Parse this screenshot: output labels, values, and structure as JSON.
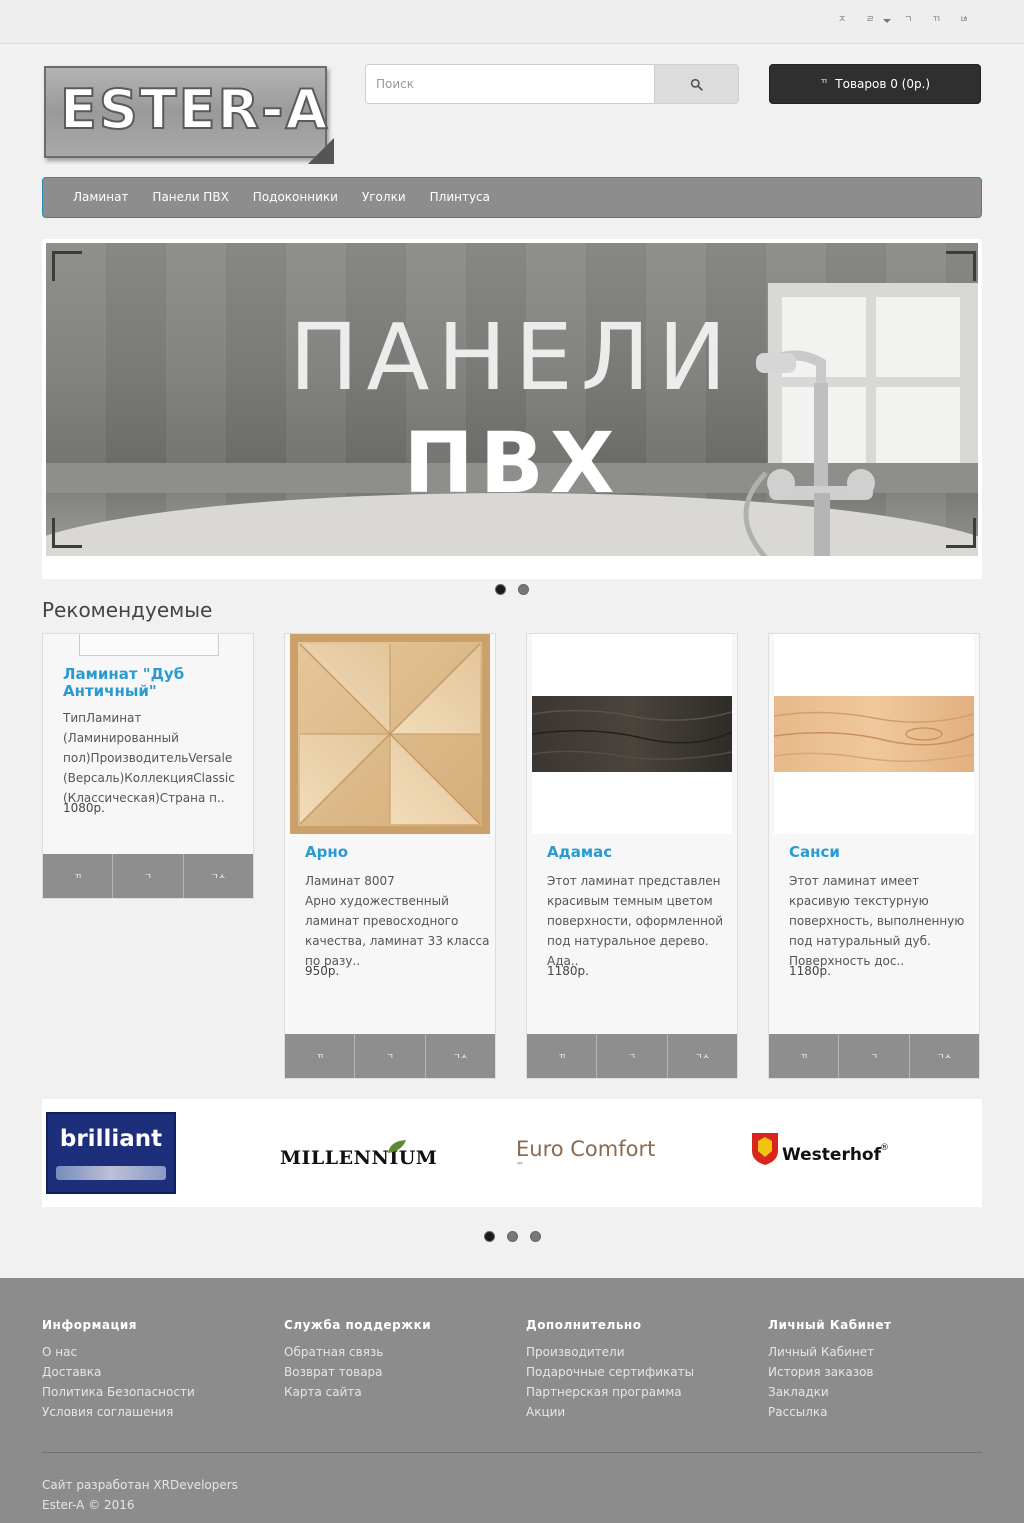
{
  "topbar": {
    "icons": [
      "ㅈ",
      "ㄹ",
      "ㄱ",
      "ㄲ",
      "ㄶ"
    ],
    "icon_names": [
      "phone-icon",
      "user-icon",
      "heart-icon",
      "cart-icon",
      "share-icon"
    ]
  },
  "logo": {
    "text": "ESTER-A"
  },
  "search": {
    "placeholder": "Поиск"
  },
  "cart": {
    "icon": "ㄲ",
    "label": "Товаров 0 (0р.)"
  },
  "nav": {
    "items": [
      "Ламинат",
      "Панели ПВХ",
      "Подоконники",
      "Уголки",
      "Плинтуса"
    ]
  },
  "banner": {
    "line1": "ПАНЕЛИ",
    "line2": "ПВХ",
    "slides": 2,
    "active": 0
  },
  "featured": {
    "title": "Рекомендуемые",
    "products": [
      {
        "name": "Ламинат \"Дуб Античный\"",
        "desc": "ТипЛаминат (Ламинированный пол)ПроизводительVersale (Версаль)КоллекцияClassic (Классическая)Страна п..",
        "price": "1080р.",
        "image": "none"
      },
      {
        "name": "Арно",
        "desc": "Ламинат 8007\nАрно художественный ламинат превосходного качества, ламинат 33 класса по разу..",
        "price": "950р.",
        "image": "parquet-tile"
      },
      {
        "name": "Адамас",
        "desc": "Этот ламинат представлен красивым темным цветом поверхности, оформленной под натуральное дерево. Ада..",
        "price": "1180р.",
        "image": "dark-oak-plank"
      },
      {
        "name": "Санси",
        "desc": "Этот ламинат имеет красивую текстурную поверхность, выполненную под натуральный дуб. Поверхность дос..",
        "price": "1180р.",
        "image": "light-oak-plank"
      }
    ],
    "button_icons": [
      "ㄲ",
      "ㄱ",
      "ㄱㅅ"
    ]
  },
  "brands": {
    "items": [
      "brilliant",
      "MILLENNIUM",
      "Euro Comfort",
      "Westerhof"
    ],
    "tm": "™",
    "reg": "®",
    "slides": 3,
    "active": 0
  },
  "footer": {
    "columns": [
      {
        "title": "Информация",
        "links": [
          "О нас",
          "Доставка",
          "Политика Безопасности",
          "Условия соглашения"
        ]
      },
      {
        "title": "Служба поддержки",
        "links": [
          "Обратная связь",
          "Возврат товара",
          "Карта сайта"
        ]
      },
      {
        "title": "Дополнительно",
        "links": [
          "Производители",
          "Подарочные сертификаты",
          "Партнерская программа",
          "Акции"
        ]
      },
      {
        "title": "Личный Кабинет",
        "links": [
          "Личный Кабинет",
          "История заказов",
          "Закладки",
          "Рассылка"
        ]
      }
    ],
    "credit": "Сайт разработан XRDevelopers",
    "copyright": "Ester-A © 2016"
  },
  "colors": {
    "accent": "#2a9bd1",
    "nav_bg": "#8d8d8d",
    "footer_bg": "#8c8c8c",
    "cart_bg": "#2f2f2f"
  }
}
